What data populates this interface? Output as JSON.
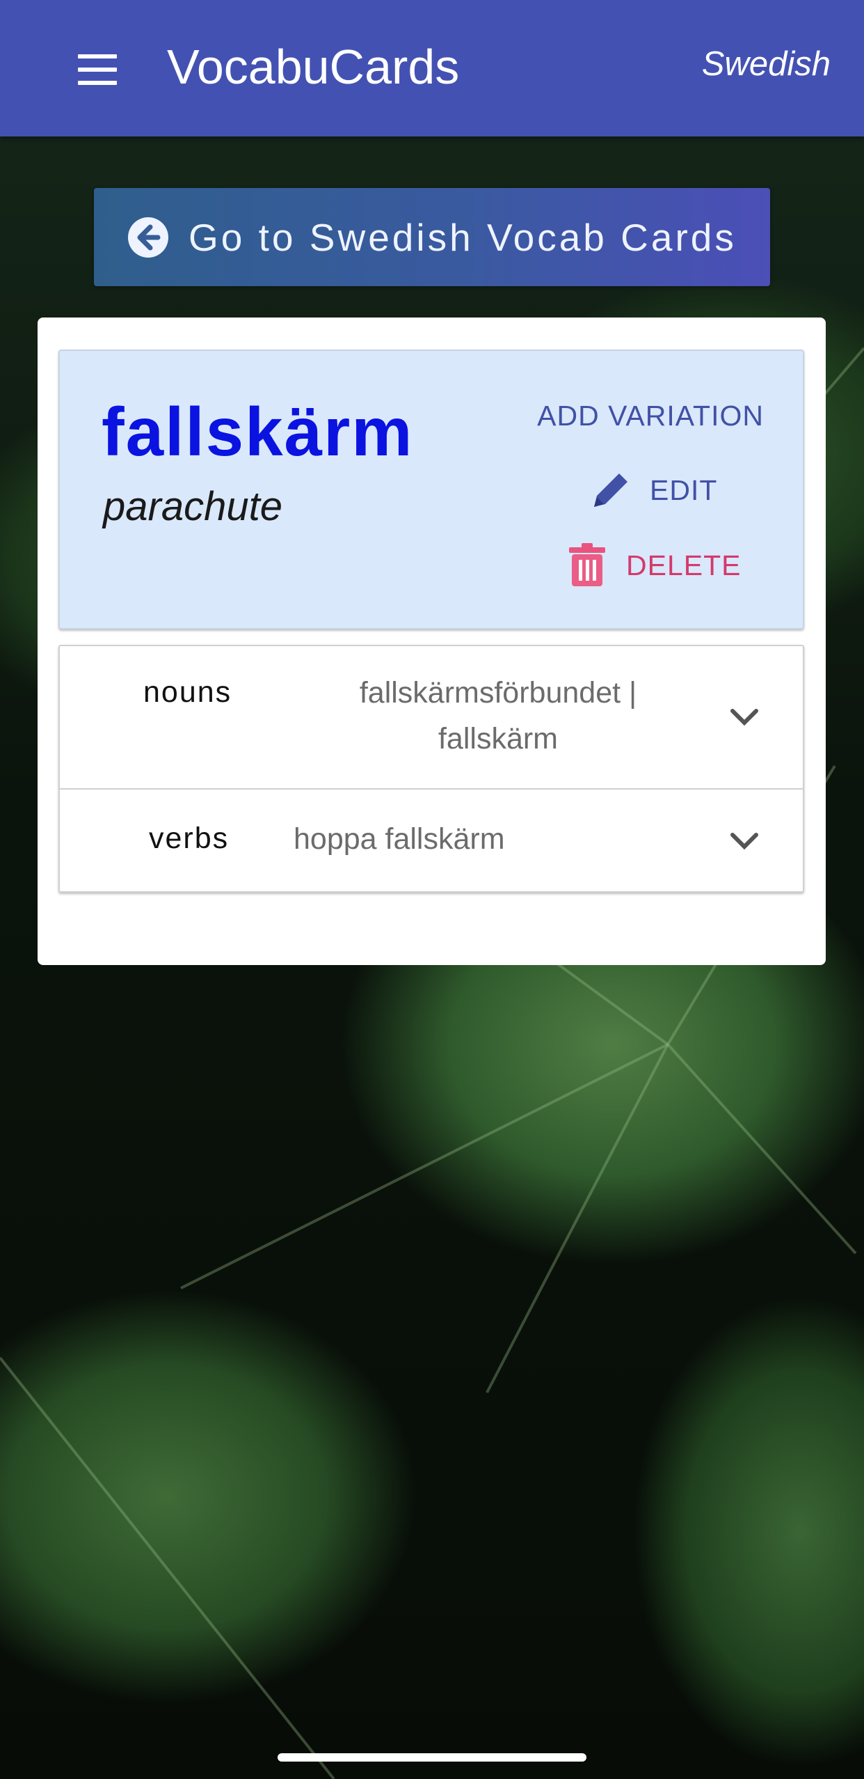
{
  "app": {
    "title": "VocabuCards",
    "language": "Swedish",
    "menu_icon": "hamburger-menu-icon"
  },
  "back_button": {
    "label": "Go to Swedish Vocab Cards",
    "icon": "arrow-left-circle-icon"
  },
  "card": {
    "word": "fallskärm",
    "translation": "parachute",
    "actions": {
      "add_variation": "ADD VARIATION",
      "edit": "EDIT",
      "delete": "DELETE"
    },
    "variations": [
      {
        "part_of_speech": "nouns",
        "line1": "fallskärmsförbundet |",
        "line2": "fallskärm"
      },
      {
        "part_of_speech": "verbs",
        "line1": "hoppa fallskärm"
      }
    ]
  },
  "colors": {
    "app_bar": "#4352b2",
    "word": "#0a13e0",
    "action_blue": "#4151a6",
    "delete_red": "#d33a6b",
    "word_panel_bg": "#dae8fc"
  }
}
